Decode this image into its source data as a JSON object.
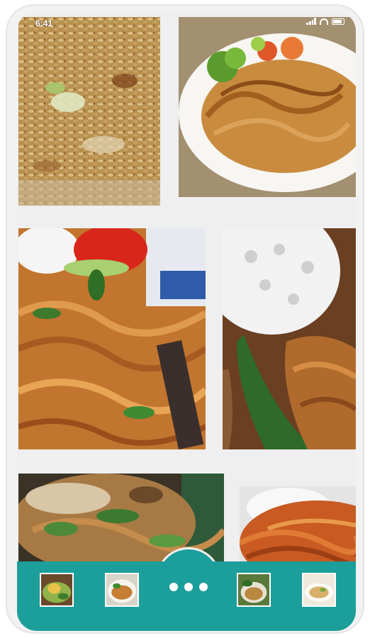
{
  "status_bar": {
    "time": "6:41",
    "icons": [
      "signal-icon",
      "wifi-icon",
      "battery-icon"
    ]
  },
  "gallery": {
    "tiles": [
      {
        "name": "fried-rice-photo"
      },
      {
        "name": "fried-noodles-plate-photo"
      },
      {
        "name": "mie-goreng-tomato-photo"
      },
      {
        "name": "noodles-with-crackers-photo"
      },
      {
        "name": "noodle-dish-greens-photo"
      },
      {
        "name": "red-noodles-photo"
      }
    ]
  },
  "bottom_nav": {
    "items": [
      {
        "name": "thumb-1"
      },
      {
        "name": "thumb-2"
      },
      {
        "name": "thumb-3"
      },
      {
        "name": "thumb-4"
      }
    ],
    "more_icon": "more-horizontal-icon"
  },
  "colors": {
    "accent": "#1c9e9a",
    "background": "#efefef"
  }
}
